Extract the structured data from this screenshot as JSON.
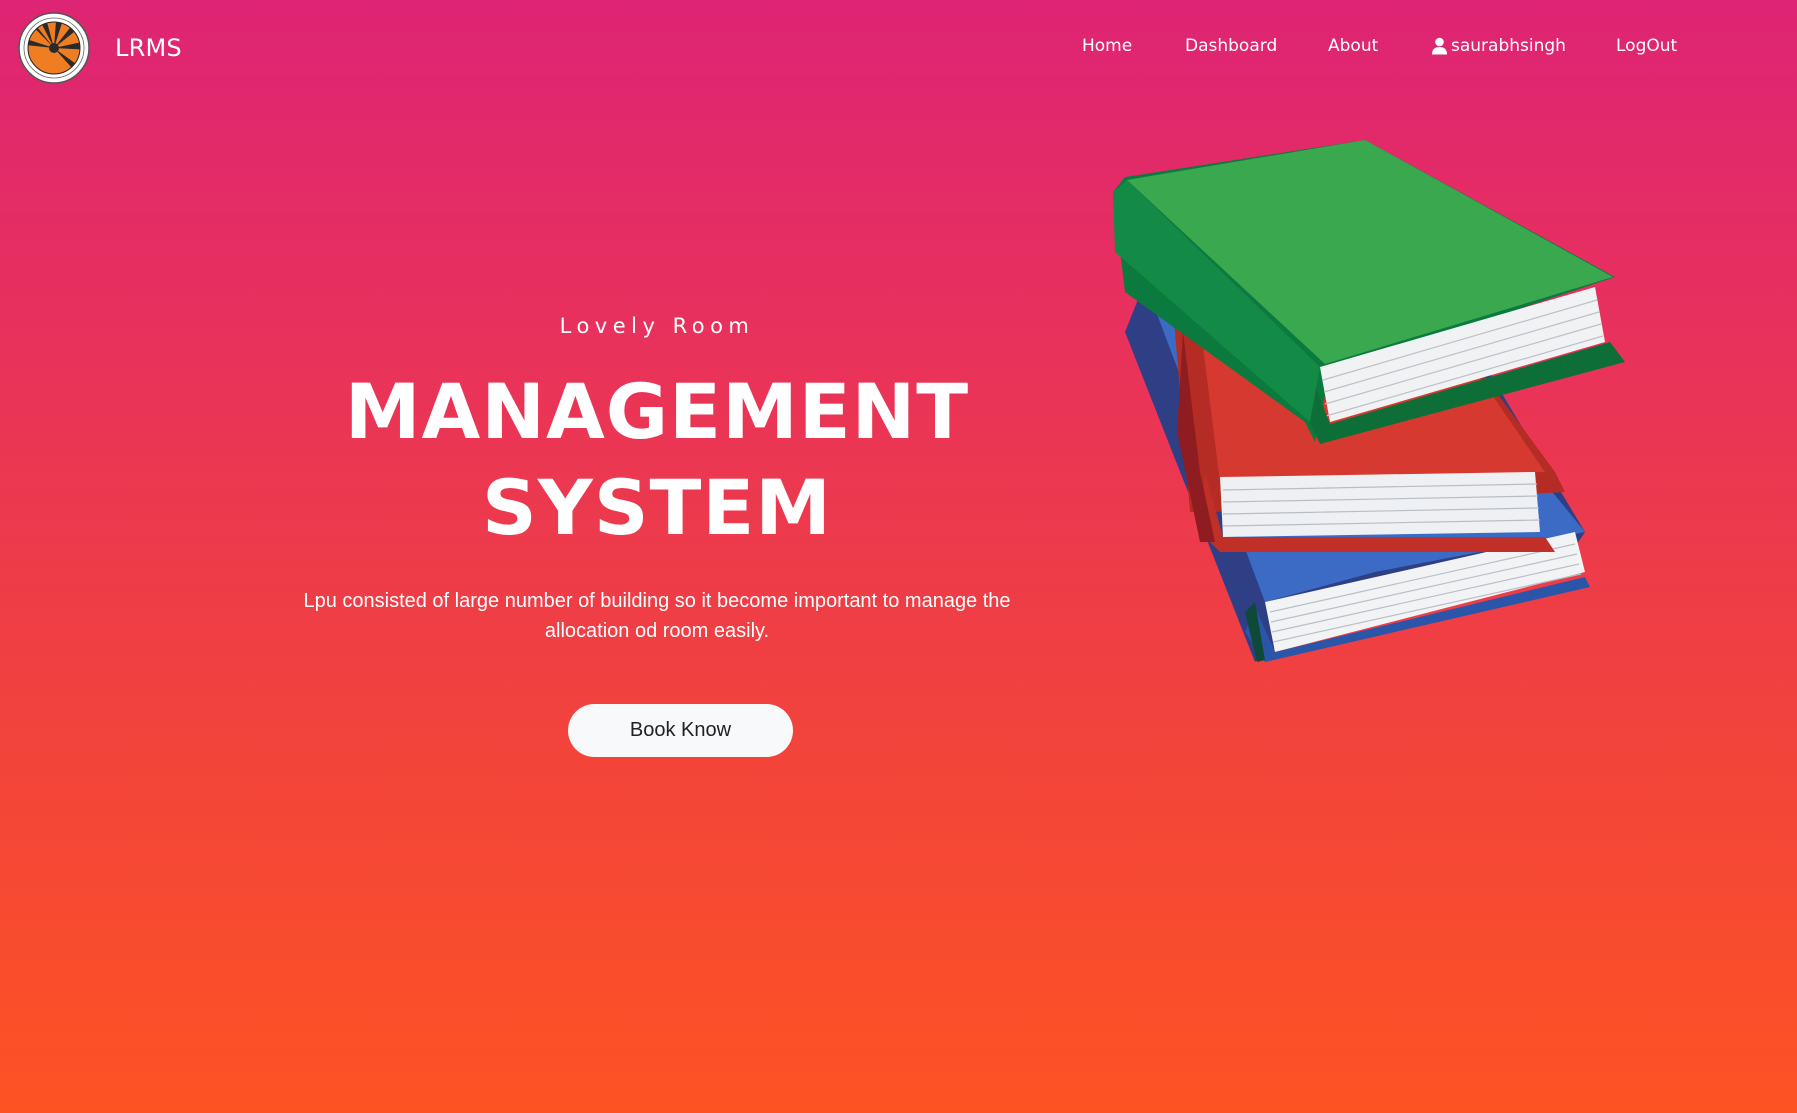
{
  "brand": {
    "name": "LRMS"
  },
  "nav": {
    "items": [
      {
        "label": "Home"
      },
      {
        "label": "Dashboard"
      },
      {
        "label": "About"
      },
      {
        "label": "saurabhsingh",
        "icon": "user-icon"
      },
      {
        "label": "LogOut"
      }
    ]
  },
  "hero": {
    "kicker": "Lovely Room",
    "headline_line1": "MANAGEMENT",
    "headline_line2": "SYSTEM",
    "description": "Lpu consisted of large number of building so it become important to manage the allocation od room easily.",
    "cta_label": "Book Know"
  },
  "colors": {
    "gradient_top": "#de2474",
    "gradient_bottom": "#fd5323",
    "button_bg": "#f8f9fa",
    "logo_orange": "#ef7d22"
  }
}
